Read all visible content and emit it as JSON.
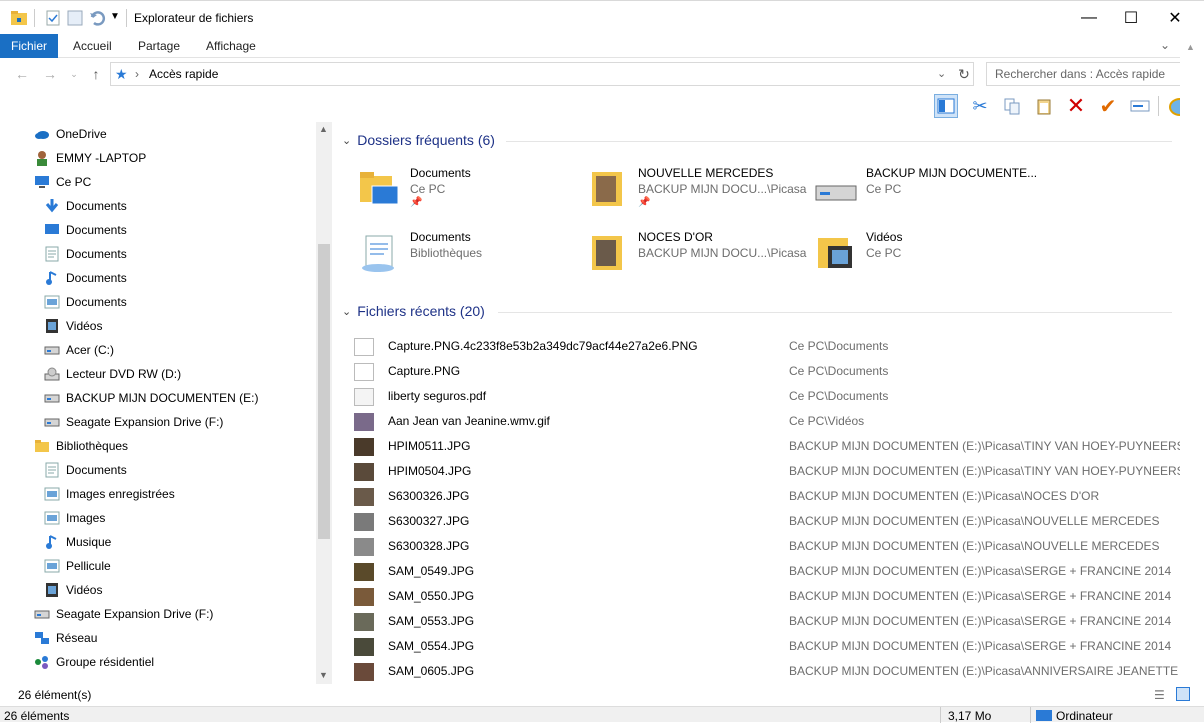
{
  "window": {
    "title": "Explorateur de fichiers",
    "controls": {
      "minimize": "—",
      "maximize": "☐",
      "close": "✕"
    }
  },
  "ribbon": {
    "tabs": [
      "Fichier",
      "Accueil",
      "Partage",
      "Affichage"
    ]
  },
  "address": {
    "breadcrumb": "Accès rapide",
    "search_placeholder": "Rechercher dans : Accès rapide"
  },
  "nav": {
    "items": [
      {
        "label": "OneDrive",
        "icon": "onedrive-icon",
        "level": 0
      },
      {
        "label": "EMMY -LAPTOP",
        "icon": "user-icon",
        "level": 0
      },
      {
        "label": "Ce PC",
        "icon": "computer-icon",
        "level": 0
      },
      {
        "label": "Documents",
        "icon": "download-icon",
        "level": 1
      },
      {
        "label": "Documents",
        "icon": "desktop-icon",
        "level": 1
      },
      {
        "label": "Documents",
        "icon": "document-icon",
        "level": 1
      },
      {
        "label": "Documents",
        "icon": "music-icon",
        "level": 1
      },
      {
        "label": "Documents",
        "icon": "picture-icon",
        "level": 1
      },
      {
        "label": "Vidéos",
        "icon": "video-icon",
        "level": 1
      },
      {
        "label": "Acer (C:)",
        "icon": "drive-icon",
        "level": 1
      },
      {
        "label": "Lecteur DVD RW (D:)",
        "icon": "dvd-icon",
        "level": 1
      },
      {
        "label": "BACKUP MIJN DOCUMENTEN (E:)",
        "icon": "drive-icon",
        "level": 1
      },
      {
        "label": "Seagate Expansion Drive (F:)",
        "icon": "drive-icon",
        "level": 1
      },
      {
        "label": "Bibliothèques",
        "icon": "library-icon",
        "level": 0
      },
      {
        "label": "Documents",
        "icon": "document-icon",
        "level": 1
      },
      {
        "label": "Images enregistrées",
        "icon": "picture-icon",
        "level": 1
      },
      {
        "label": "Images",
        "icon": "picture-icon",
        "level": 1
      },
      {
        "label": "Musique",
        "icon": "music-icon",
        "level": 1
      },
      {
        "label": "Pellicule",
        "icon": "picture-icon",
        "level": 1
      },
      {
        "label": "Vidéos",
        "icon": "video-icon",
        "level": 1
      },
      {
        "label": "Seagate Expansion Drive (F:)",
        "icon": "drive-icon",
        "level": 0
      },
      {
        "label": "Réseau",
        "icon": "network-icon",
        "level": 0
      },
      {
        "label": "Groupe résidentiel",
        "icon": "homegroup-icon",
        "level": 0
      }
    ]
  },
  "frequent": {
    "header": "Dossiers fréquents (6)",
    "folders": [
      {
        "name": "Documents",
        "sub": "Ce PC",
        "pinned": true
      },
      {
        "name": "NOUVELLE MERCEDES",
        "sub": "BACKUP MIJN DOCU...\\Picasa",
        "pinned": true
      },
      {
        "name": "BACKUP MIJN DOCUMENTE...",
        "sub": "Ce PC",
        "pinned": false
      },
      {
        "name": "Documents",
        "sub": "Bibliothèques",
        "pinned": false
      },
      {
        "name": "NOCES D'OR",
        "sub": "BACKUP MIJN DOCU...\\Picasa",
        "pinned": false
      },
      {
        "name": "Vidéos",
        "sub": "Ce PC",
        "pinned": false
      }
    ]
  },
  "recent": {
    "header": "Fichiers récents (20)",
    "files": [
      {
        "name": "Capture.PNG.4c233f8e53b2a349dc79acf44e27a2e6.PNG",
        "location": "Ce PC\\Documents"
      },
      {
        "name": "Capture.PNG",
        "location": "Ce PC\\Documents"
      },
      {
        "name": "liberty seguros.pdf",
        "location": "Ce PC\\Documents"
      },
      {
        "name": "Aan Jean van Jeanine.wmv.gif",
        "location": "Ce PC\\Vidéos"
      },
      {
        "name": "HPIM0511.JPG",
        "location": "BACKUP MIJN DOCUMENTEN (E:)\\Picasa\\TINY VAN HOEY-PUYNEERS"
      },
      {
        "name": "HPIM0504.JPG",
        "location": "BACKUP MIJN DOCUMENTEN (E:)\\Picasa\\TINY VAN HOEY-PUYNEERS"
      },
      {
        "name": "S6300326.JPG",
        "location": "BACKUP MIJN DOCUMENTEN (E:)\\Picasa\\NOCES D'OR"
      },
      {
        "name": "S6300327.JPG",
        "location": "BACKUP MIJN DOCUMENTEN (E:)\\Picasa\\NOUVELLE MERCEDES"
      },
      {
        "name": "S6300328.JPG",
        "location": "BACKUP MIJN DOCUMENTEN (E:)\\Picasa\\NOUVELLE MERCEDES"
      },
      {
        "name": "SAM_0549.JPG",
        "location": "BACKUP MIJN DOCUMENTEN (E:)\\Picasa\\SERGE + FRANCINE 2014"
      },
      {
        "name": "SAM_0550.JPG",
        "location": "BACKUP MIJN DOCUMENTEN (E:)\\Picasa\\SERGE + FRANCINE 2014"
      },
      {
        "name": "SAM_0553.JPG",
        "location": "BACKUP MIJN DOCUMENTEN (E:)\\Picasa\\SERGE + FRANCINE 2014"
      },
      {
        "name": "SAM_0554.JPG",
        "location": "BACKUP MIJN DOCUMENTEN (E:)\\Picasa\\SERGE + FRANCINE 2014"
      },
      {
        "name": "SAM_0605.JPG",
        "location": "BACKUP MIJN DOCUMENTEN (E:)\\Picasa\\ANNIVERSAIRE JEANETTE"
      }
    ]
  },
  "status": {
    "count": "26 élément(s)",
    "bottom_count": "26 éléments",
    "size": "3,17 Mo",
    "computer": "Ordinateur"
  },
  "colors": {
    "accent": "#1a6fc4",
    "group_header": "#1e3287",
    "muted": "#6d6d6d"
  }
}
